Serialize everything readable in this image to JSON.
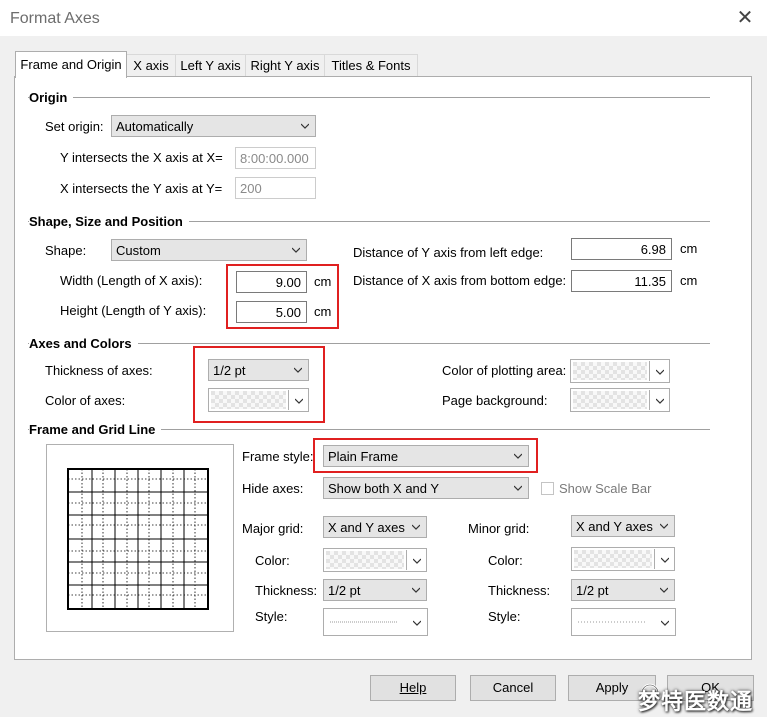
{
  "window": {
    "title": "Format Axes",
    "close_label": "✕"
  },
  "tabs": [
    "Frame and Origin",
    "X axis",
    "Left Y axis",
    "Right Y axis",
    "Titles & Fonts"
  ],
  "origin": {
    "section_title": "Origin",
    "set_origin_label": "Set origin:",
    "set_origin_value": "Automatically",
    "y_intersects_label": "Y intersects the X axis at X=",
    "y_intersects_value": "8:00:00.000",
    "x_intersects_label": "X intersects the Y axis at Y=",
    "x_intersects_value": "200"
  },
  "shape": {
    "section_title": "Shape, Size and Position",
    "shape_label": "Shape:",
    "shape_value": "Custom",
    "width_label": "Width (Length of X axis):",
    "width_value": "9.00",
    "width_unit": "cm",
    "height_label": "Height (Length of Y axis):",
    "height_value": "5.00",
    "height_unit": "cm",
    "dist_y_label": "Distance of Y axis from left edge:",
    "dist_y_value": "6.98",
    "dist_y_unit": "cm",
    "dist_x_label": "Distance of X axis from bottom edge:",
    "dist_x_value": "11.35",
    "dist_x_unit": "cm"
  },
  "axes_colors": {
    "section_title": "Axes and Colors",
    "thickness_label": "Thickness of axes:",
    "thickness_value": "1/2 pt",
    "color_axes_label": "Color of axes:",
    "plot_area_label": "Color of plotting area:",
    "page_bg_label": "Page background:"
  },
  "frame_grid": {
    "section_title": "Frame and Grid Line",
    "frame_style_label": "Frame style:",
    "frame_style_value": "Plain Frame",
    "hide_axes_label": "Hide axes:",
    "hide_axes_value": "Show both X and Y",
    "show_scale_bar_label": "Show Scale Bar",
    "major": {
      "label": "Major grid:",
      "value": "X and Y axes",
      "color_label": "Color:",
      "thickness_label": "Thickness:",
      "thickness_value": "1/2 pt",
      "style_label": "Style:"
    },
    "minor": {
      "label": "Minor grid:",
      "value": "X and Y axes",
      "color_label": "Color:",
      "thickness_label": "Thickness:",
      "thickness_value": "1/2 pt",
      "style_label": "Style:"
    }
  },
  "buttons": {
    "help": "Help",
    "cancel": "Cancel",
    "apply": "Apply",
    "ok": "OK"
  },
  "watermark": "梦特医数通",
  "colors": {
    "highlight": "#e02020",
    "panel_border": "#adadad",
    "dialog_bg": "#f0f0f0"
  }
}
